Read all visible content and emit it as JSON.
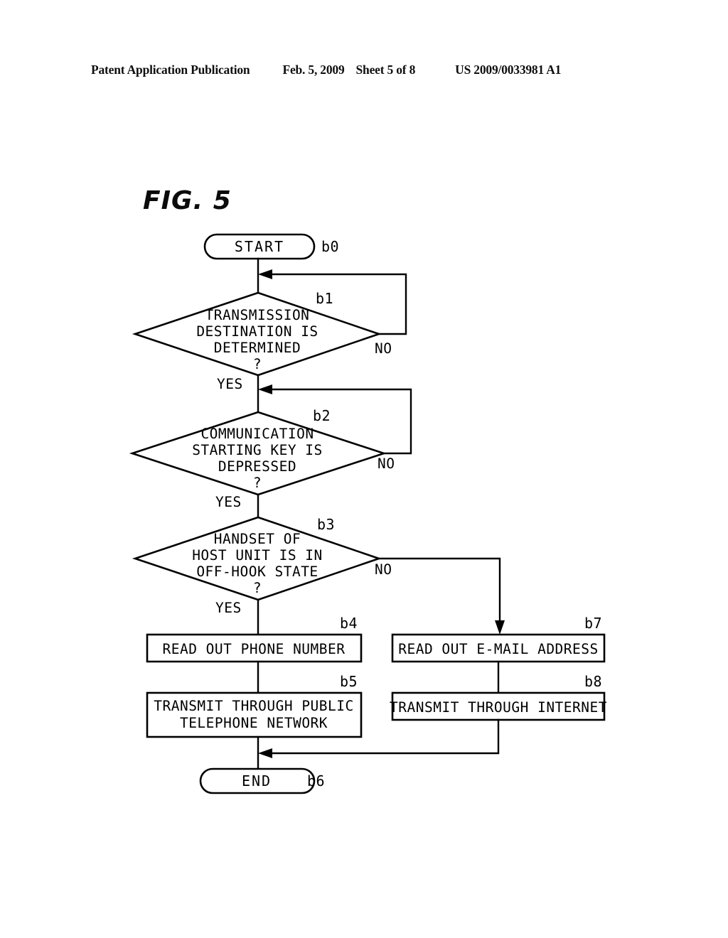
{
  "header": {
    "publication": "Patent Application Publication",
    "date": "Feb. 5, 2009",
    "sheet": "Sheet 5 of 8",
    "patent_number": "US 2009/0033981 A1"
  },
  "figure": {
    "title": "FIG. 5"
  },
  "flowchart": {
    "start": {
      "label": "START",
      "id": "b0"
    },
    "end": {
      "label": "END",
      "id": "b6"
    },
    "decisions": [
      {
        "id": "b1",
        "lines": [
          "TRANSMISSION",
          "DESTINATION IS",
          "DETERMINED"
        ],
        "question_mark": "?",
        "yes_label": "YES",
        "no_label": "NO"
      },
      {
        "id": "b2",
        "lines": [
          "COMMUNICATION",
          "STARTING KEY IS",
          "DEPRESSED"
        ],
        "question_mark": "?",
        "yes_label": "YES",
        "no_label": "NO"
      },
      {
        "id": "b3",
        "lines": [
          "HANDSET OF",
          "HOST UNIT IS IN",
          "OFF-HOOK STATE"
        ],
        "question_mark": "?",
        "yes_label": "YES",
        "no_label": "NO"
      }
    ],
    "processes": [
      {
        "id": "b4",
        "lines": [
          "READ OUT PHONE NUMBER"
        ]
      },
      {
        "id": "b5",
        "lines": [
          "TRANSMIT THROUGH PUBLIC",
          "TELEPHONE NETWORK"
        ]
      },
      {
        "id": "b7",
        "lines": [
          "READ OUT E-MAIL ADDRESS"
        ]
      },
      {
        "id": "b8",
        "lines": [
          "TRANSMIT THROUGH INTERNET"
        ]
      }
    ]
  },
  "colors": {
    "ink": "#000000",
    "paper": "#ffffff"
  }
}
